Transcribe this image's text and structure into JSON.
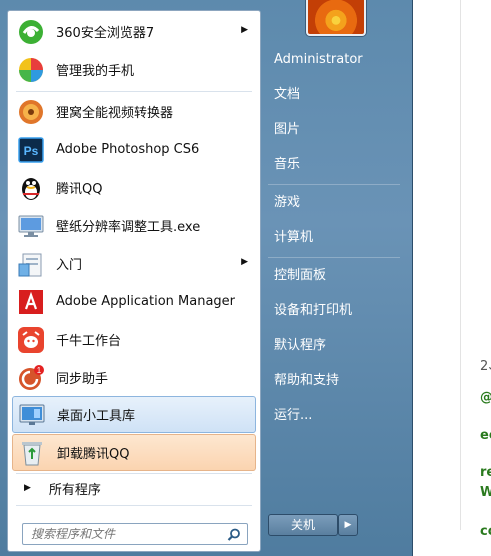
{
  "programs": [
    {
      "label": "360安全浏览器7",
      "icon": "360-browser-icon",
      "submenu": true
    },
    {
      "label": "管理我的手机",
      "icon": "phone-manager-icon",
      "submenu": false
    },
    {
      "label": "狸窝全能视频转换器",
      "icon": "video-converter-icon",
      "submenu": false
    },
    {
      "label": "Adobe Photoshop CS6",
      "icon": "photoshop-icon",
      "submenu": false,
      "badge": "Ps"
    },
    {
      "label": "腾讯QQ",
      "icon": "qq-penguin-icon",
      "submenu": false
    },
    {
      "label": "壁纸分辨率调整工具.exe",
      "icon": "monitor-icon",
      "submenu": false
    },
    {
      "label": "入门",
      "icon": "getting-started-icon",
      "submenu": true
    },
    {
      "label": "Adobe Application Manager",
      "icon": "adobe-icon",
      "submenu": false
    },
    {
      "label": "千牛工作台",
      "icon": "qianniu-icon",
      "submenu": false
    },
    {
      "label": "同步助手",
      "icon": "sync-assistant-icon",
      "submenu": false,
      "badge": "1"
    },
    {
      "label": "桌面小工具库",
      "icon": "gadgets-icon",
      "submenu": false
    },
    {
      "label": "卸载腾讯QQ",
      "icon": "recycle-bin-icon",
      "submenu": false
    }
  ],
  "all_programs": "所有程序",
  "search": {
    "placeholder": "搜索程序和文件"
  },
  "right": {
    "user": "Administrator",
    "items": [
      "文档",
      "图片",
      "音乐",
      "游戏",
      "计算机",
      "控制面板",
      "设备和打印机",
      "默认程序",
      "帮助和支持",
      "运行..."
    ]
  },
  "shutdown": {
    "label": "关机"
  },
  "background_doc": {
    "lines": [
      "2、",
      "@",
      "ec",
      "re",
      "W",
      "cc"
    ]
  },
  "colors": {
    "menu_bg": "#5d8aad",
    "highlight_blue": "#cfe2f6",
    "highlight_orange": "#fbd4b0"
  }
}
